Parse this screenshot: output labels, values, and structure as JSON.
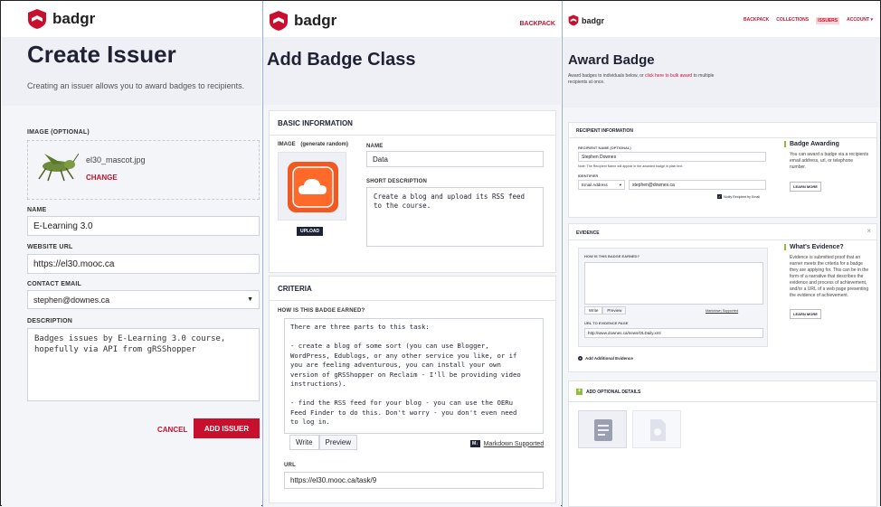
{
  "panel1": {
    "brand": "badgr",
    "title": "Create Issuer",
    "subtitle": "Creating an issuer allows you to award badges to recipients.",
    "image_label": "IMAGE (OPTIONAL)",
    "image_filename": "el30_mascot.jpg",
    "change_label": "CHANGE",
    "name_label": "NAME",
    "name_value": "E-Learning 3.0",
    "website_label": "WEBSITE URL",
    "website_value": "https://el30.mooc.ca",
    "email_label": "CONTACT EMAIL",
    "email_value": "stephen@downes.ca",
    "description_label": "DESCRIPTION",
    "description_value": "Badges issues by E-Learning 3.0 course,\nhopefully via API from gRSShopper",
    "cancel_label": "CANCEL",
    "add_label": "ADD ISSUER"
  },
  "panel2": {
    "brand": "badgr",
    "nav_backpack": "BACKPACK",
    "title": "Add Badge Class",
    "basic_info_title": "BASIC INFORMATION",
    "image_label": "IMAGE",
    "generate_random": "(generate random)",
    "upload_label": "UPLOAD",
    "name_label": "NAME",
    "name_value": "Data",
    "short_desc_label": "SHORT DESCRIPTION",
    "short_desc_value": "Create a blog and upload its RSS feed\nto the course.",
    "criteria_title": "CRITERIA",
    "earned_label": "HOW IS THIS BADGE EARNED?",
    "earned_value": "There are three parts to this task:\n\n- create a blog of some sort (you can use Blogger,\nWordPress, Edublogs, or any other service you like, or if\nyou are feeling adventurous, you can install your own\nversion of gRSShopper on Reclaim - I'll be providing video\ninstructions).\n\n- find the RSS feed for your blog - you can use the OERu\nFeed Finder to do this. Don't worry - you don't even need\nto log in.\n\n- Enter the RSS Feed URL into the form I will be providing",
    "write_tab": "Write",
    "preview_tab": "Preview",
    "markdown_badge": "M↓",
    "markdown_link": "Markdown Supported",
    "url_label": "URL",
    "url_value": "https://el30.mooc.ca/task/9"
  },
  "panel3": {
    "brand": "badgr",
    "nav": [
      "BACKPACK",
      "COLLECTIONS",
      "ISSUERS",
      "ACCOUNT ▾"
    ],
    "title": "Award Badge",
    "subtitle_a": "Award badges to individuals below, or ",
    "subtitle_link": "click here to bulk award",
    "subtitle_b": " to multiple recipients at once.",
    "recipient_title": "RECIPIENT INFORMATION",
    "recipient_name_label": "RECIPIENT NAME (OPTIONAL)",
    "recipient_name_value": "Stephen Downes",
    "recipient_note": "Note: The Recipient Name will appear in the awarded badge in plain text.",
    "identifier_label": "IDENTIFIER",
    "identifier_type": "Email Address",
    "identifier_value": "stephen@downes.ca",
    "notify_label": "Notify Recipient by Email",
    "aside1_title": "Badge Awarding",
    "aside1_text": "You can award a badge via a recipients email address, url, or telephone number.",
    "learn_more": "LEARN MORE",
    "evidence_title": "EVIDENCE",
    "evidence_q_label": "HOW IS THIS BADGE EARNED?",
    "write_tab": "Write",
    "preview_tab": "Preview",
    "markdown_link": "Markdown Supported",
    "evidence_url_label": "URL TO EVIDENCE PAGE",
    "evidence_url_value": "http://www.downes.ca/news/OLDaily.xml",
    "add_evidence": "Add Additional Evidence",
    "aside2_title": "What's Evidence?",
    "aside2_text": "Evidence is submitted proof that an earner meets the criteria for a badge they are applying for. This can be in the form of a narrative that describes the evidence and process of achievement, and/or a URL of a web page presenting the evidence of achievement.",
    "optional_title": "ADD OPTIONAL DETAILS",
    "close_glyph": "×"
  }
}
